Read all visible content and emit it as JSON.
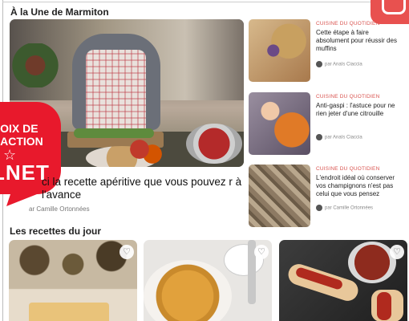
{
  "section_title": "À la Une de Marmiton",
  "hero": {
    "title": "ci la recette apéritive que vous pouvez r à l'avance",
    "author": "ar Camille Ortonnées",
    "image_icon": "kitchen-photo"
  },
  "badge": {
    "line1": "HOIX DE",
    "line2": "DACTION",
    "star": "☆",
    "net": "LNET",
    "color": "#e8192c"
  },
  "side_articles": [
    {
      "kicker": "CUISINE DU QUOTIDIEN",
      "title": "Cette étape à faire absolument pour réussir des muffins",
      "author": "par Anaïs Ciaccia"
    },
    {
      "kicker": "CUISINE DU QUOTIDIEN",
      "title": "Anti-gaspi : l'astuce pour ne rien jeter d'une citrouille",
      "author": "par Anaïs Ciaccia"
    },
    {
      "kicker": "CUISINE DU QUOTIDIEN",
      "title": "L'endroit idéal où conserver vos champignons n'est pas celui que vous pensez",
      "author": "par Camille Ortonnées"
    }
  ],
  "recipes_title": "Les recettes du jour",
  "recipes": [
    {
      "image": "cake-and-chestnuts",
      "fav_icon": "♡"
    },
    {
      "image": "quiche",
      "fav_icon": "♡"
    },
    {
      "image": "halloween-hot-dogs",
      "fav_icon": "♡"
    }
  ],
  "colors": {
    "accent": "#e8514f",
    "kicker": "#d9534f"
  }
}
